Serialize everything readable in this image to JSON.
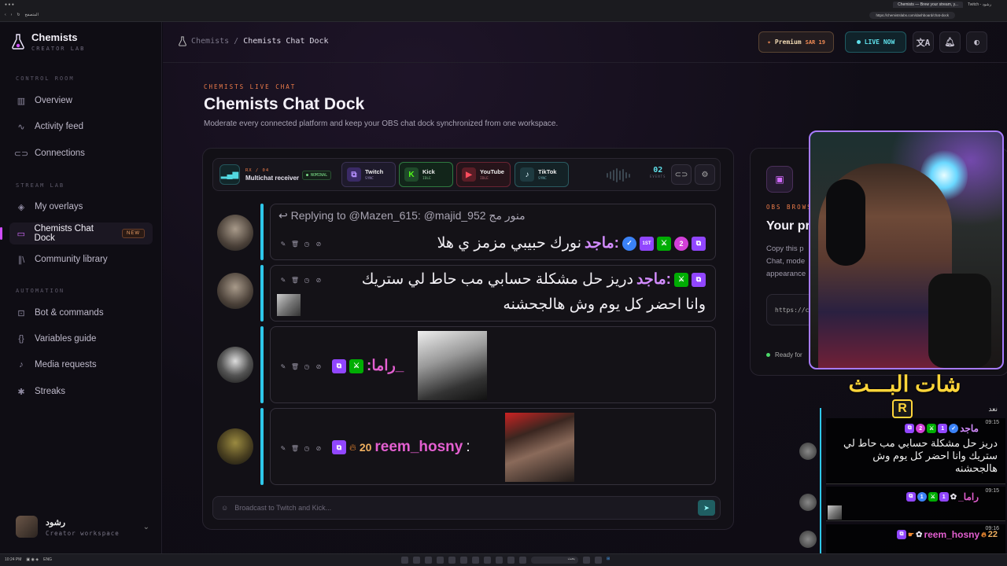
{
  "browser": {
    "tab_active": "Chemists — Brew your stream, y...",
    "tab_other": "Twitch - رشود",
    "url": "https://chemistslabs.com/dashboard/chat-dock",
    "bookmarks_label": "المتصفح"
  },
  "brand": {
    "name": "Chemists",
    "tagline": "CREATOR LAB"
  },
  "sidebar": {
    "sections": [
      {
        "title": "CONTROL ROOM",
        "items": [
          {
            "label": "Overview",
            "icon": "chart-icon"
          },
          {
            "label": "Activity feed",
            "icon": "pulse-icon"
          },
          {
            "label": "Connections",
            "icon": "link-icon"
          }
        ]
      },
      {
        "title": "STREAM LAB",
        "items": [
          {
            "label": "My overlays",
            "icon": "layers-icon"
          },
          {
            "label": "Chemists Chat Dock",
            "icon": "chat-icon",
            "badge": "NEW",
            "active": true
          },
          {
            "label": "Community library",
            "icon": "library-icon"
          }
        ]
      },
      {
        "title": "AUTOMATION",
        "items": [
          {
            "label": "Bot & commands",
            "icon": "bot-icon"
          },
          {
            "label": "Variables guide",
            "icon": "braces-icon"
          },
          {
            "label": "Media requests",
            "icon": "music-icon"
          },
          {
            "label": "Streaks",
            "icon": "flame-icon"
          }
        ]
      }
    ],
    "user": {
      "name": "رشود",
      "role": "Creator workspace"
    }
  },
  "header": {
    "breadcrumb_root": "Chemists",
    "breadcrumb_sep": "/",
    "breadcrumb_current": "Chemists Chat Dock",
    "premium_label": "Premium",
    "premium_price": "SAR 19",
    "live_label": "LIVE NOW"
  },
  "page": {
    "eyebrow": "CHEMISTS LIVE CHAT",
    "title": "Chemists Chat Dock",
    "subtitle": "Moderate every connected platform and keep your OBS chat dock synchronized from one workspace."
  },
  "toolbar": {
    "rx_label": "RX / 04",
    "rx_title": "Multichat receiver",
    "nominal": "● NOMINAL",
    "platforms": [
      {
        "name": "Twitch",
        "status": "SYNC"
      },
      {
        "name": "Kick",
        "status": "IDLE"
      },
      {
        "name": "YouTube",
        "status": "IDLE"
      },
      {
        "name": "TikTok",
        "status": "SYNC"
      }
    ],
    "events_count": "02",
    "events_label": "EVENTS"
  },
  "messages": [
    {
      "reply_to": "↩ Replying to @Mazen_615: @majid_952 منور مج",
      "user": "ماجد:",
      "text": "نورك حبيبي مزمز ي هلا",
      "num_badge": "2",
      "sub_badge": "1ST"
    },
    {
      "user": "ماجد:",
      "text": "دريز حل مشكلة حسابي مب حاط لي ستريك",
      "text2": "وانا احضر كل يوم وش هالجحشنه"
    },
    {
      "user": "_راما:",
      "text": ""
    },
    {
      "user": "reem_hosny",
      "points": "20",
      "sep": ":"
    }
  ],
  "composer": {
    "placeholder": "Broadcast to Twitch and Kick..."
  },
  "obs_panel": {
    "eyebrow": "OBS BROWS",
    "title": "Your pr",
    "desc": "Copy this p Chat, mode appearance",
    "url": "https://c",
    "status": "Ready for"
  },
  "overlay": {
    "title": "شات البـــث",
    "logo": "R",
    "partial_text": "نعد",
    "messages": [
      {
        "time": "09:15",
        "user": "ماجد",
        "num": "2",
        "text": "دريز حل مشكلة حسابي مب حاط لي ستريك وانا احضر كل يوم وش هالجحشنه"
      },
      {
        "time": "09:15",
        "user": "_راما",
        "num": "1",
        "text": ""
      },
      {
        "time": "09:16",
        "user": "reem_hosny",
        "num": "22",
        "text": ""
      }
    ]
  },
  "taskbar": {
    "lang": "ENG",
    "time": "10:24 PM",
    "search": "بحث"
  },
  "colors": {
    "accent": "#d14dff",
    "live": "#5fe0ea",
    "orange": "#ee7c4a",
    "twitch": "#9146ff",
    "kick": "#53fc18"
  }
}
